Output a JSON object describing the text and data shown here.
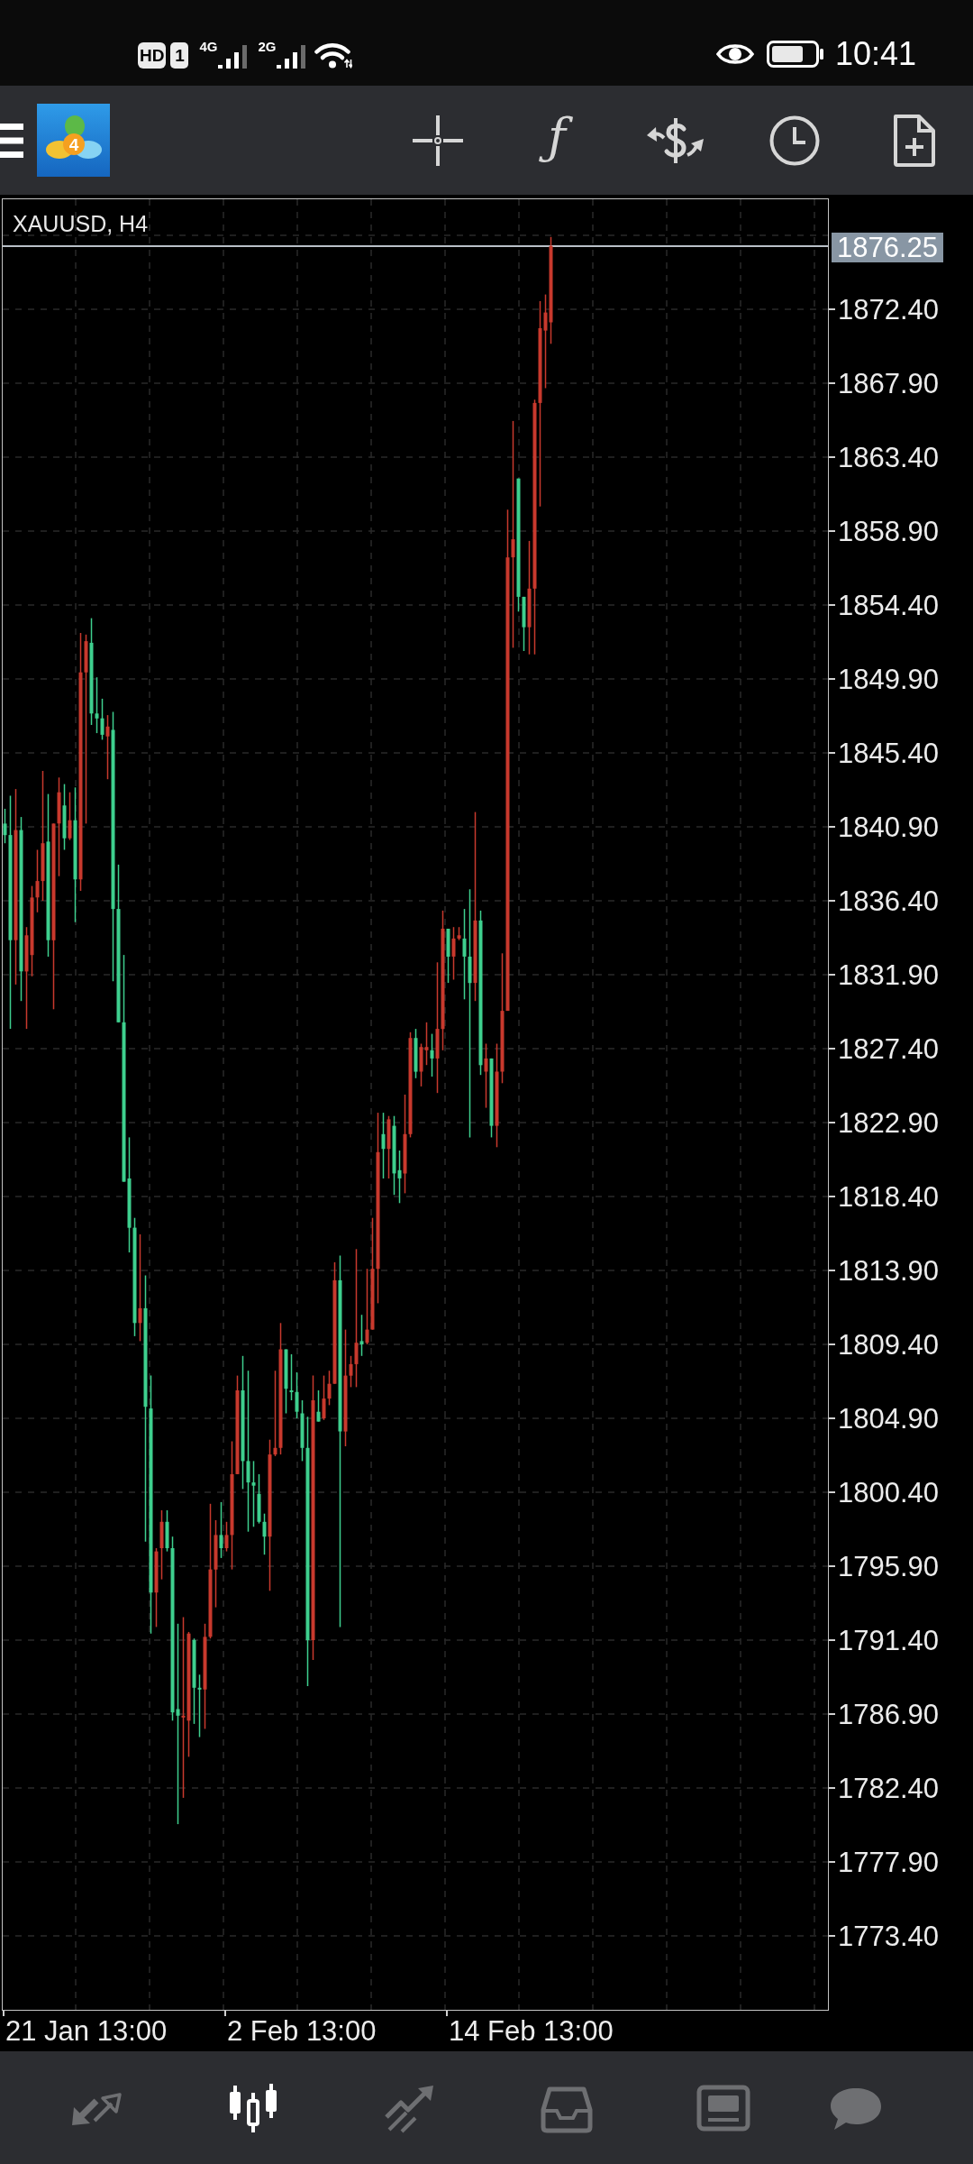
{
  "status_bar": {
    "hd_label": "HD",
    "sim_label": "1",
    "networks": [
      {
        "type": "4G"
      },
      {
        "type": "2G"
      }
    ],
    "time": "10:41"
  },
  "toolbar": {
    "logo_digit": "4",
    "tools": [
      {
        "kind": "crosshair"
      },
      {
        "kind": "function",
        "label": "ƒ"
      },
      {
        "kind": "trade"
      },
      {
        "kind": "period"
      },
      {
        "kind": "document"
      }
    ]
  },
  "chart": {
    "title": "XAUUSD, H4",
    "current_price": "1876.25",
    "price_labels": [
      "1872.40",
      "1867.90",
      "1863.40",
      "1858.90",
      "1854.40",
      "1849.90",
      "1845.40",
      "1840.90",
      "1836.40",
      "1831.90",
      "1827.40",
      "1822.90",
      "1818.40",
      "1813.90",
      "1809.40",
      "1804.90",
      "1800.40",
      "1795.90",
      "1791.40",
      "1786.90",
      "1782.40",
      "1777.90",
      "1773.40"
    ],
    "time_labels": [
      "21 Jan 13:00",
      "2 Feb 13:00",
      "14 Feb 13:00"
    ]
  },
  "bottom_nav": [
    {
      "kind": "quotes",
      "selected": false
    },
    {
      "kind": "chart",
      "selected": true
    },
    {
      "kind": "trade",
      "selected": false
    },
    {
      "kind": "history",
      "selected": false
    },
    {
      "kind": "news",
      "selected": false
    },
    {
      "kind": "chat",
      "selected": false
    }
  ]
}
